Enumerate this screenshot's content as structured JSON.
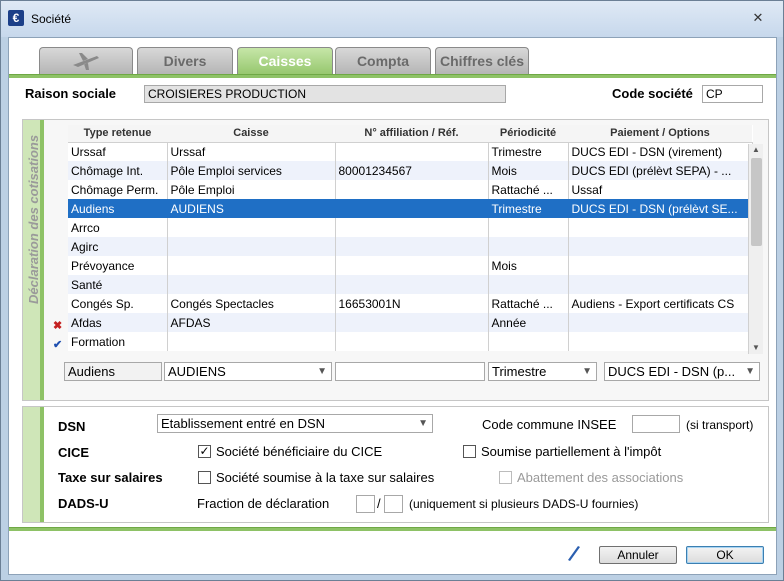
{
  "window": {
    "title": "Société",
    "close_glyph": "✕",
    "app_icon": "€"
  },
  "tabs": [
    {
      "label": "",
      "icon": "plane-icon"
    },
    {
      "label": "Divers"
    },
    {
      "label": "Caisses",
      "active": true
    },
    {
      "label": "Compta"
    },
    {
      "label": "Chiffres clés"
    }
  ],
  "company": {
    "name_label": "Raison sociale",
    "name_value": "CROISIERES PRODUCTION",
    "code_label": "Code société",
    "code_value": "CP"
  },
  "cotisations": {
    "side_label": "Déclaration des cotisations",
    "columns": [
      "Type retenue",
      "Caisse",
      "N° affiliation / Réf.",
      "Périodicité",
      "Paiement / Options"
    ],
    "rows": [
      [
        "Urssaf",
        "Urssaf",
        "",
        "Trimestre",
        "DUCS EDI - DSN (virement)"
      ],
      [
        "Chômage Int.",
        "Pôle Emploi services",
        "80001234567",
        "Mois",
        "DUCS EDI (prélèvt SEPA) - ..."
      ],
      [
        "Chômage Perm.",
        "Pôle Emploi",
        "",
        "Rattaché ...",
        "Ussaf"
      ],
      [
        "Audiens",
        "AUDIENS",
        "",
        "Trimestre",
        "DUCS EDI - DSN (prélèvt SE..."
      ],
      [
        "Arrco",
        "",
        "",
        "",
        ""
      ],
      [
        "Agirc",
        "",
        "",
        "",
        ""
      ],
      [
        "Prévoyance",
        "",
        "",
        "Mois",
        ""
      ],
      [
        "Santé",
        "",
        "",
        "",
        ""
      ],
      [
        "Congés Sp.",
        "Congés Spectacles",
        "16653001N",
        "Rattaché ...",
        "Audiens - Export certificats CS"
      ],
      [
        "Afdas",
        "AFDAS",
        "",
        "Année",
        ""
      ],
      [
        "Formation",
        "",
        "",
        "",
        ""
      ]
    ],
    "selected_row": 3,
    "row_marks": {
      "delete": "✖",
      "confirm": "✔"
    },
    "edit": {
      "type": "Audiens",
      "caisse": "AUDIENS",
      "affiliation": "",
      "periodicite": "Trimestre",
      "paiement": "DUCS EDI - DSN (p..."
    }
  },
  "options": {
    "dsn_label": "DSN",
    "dsn_value": "Etablissement entré en DSN",
    "insee_label": "Code commune INSEE",
    "insee_value": "",
    "insee_hint": "(si transport)",
    "cice_label": "CICE",
    "cice_checkbox": "Société bénéficiaire du CICE",
    "cice_checked": true,
    "partial_checkbox": "Soumise partiellement à l'impôt",
    "partial_checked": false,
    "taxe_label": "Taxe sur salaires",
    "taxe_checkbox": "Société soumise à la taxe sur salaires",
    "taxe_checked": false,
    "abattement_checkbox": "Abattement des associations",
    "abattement_checked": false,
    "dadsu_label": "DADS-U",
    "fraction_label": "Fraction de déclaration",
    "fraction_sep": "/",
    "fraction_hint": "(uniquement si plusieurs DADS-U fournies)"
  },
  "footer": {
    "cancel": "Annuler",
    "ok": "OK",
    "edit_icon": "pen-icon"
  },
  "colors": {
    "accent_green": "#8ec266",
    "selection": "#1f6fc5",
    "window_bg": "#bcd0e4"
  }
}
